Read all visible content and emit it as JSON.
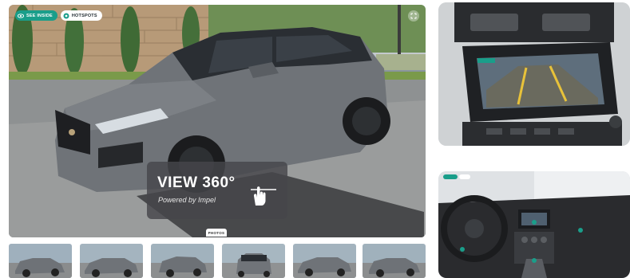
{
  "viewer": {
    "see_inside_label": "SEE INSIDE",
    "hotspots_label": "HOTSPOTS",
    "view360_title": "VIEW 360°",
    "view360_subtitle": "Powered by Impel",
    "photos_tab_label": "PHOTOS"
  },
  "icons": {
    "see_inside": "eye-icon",
    "hotspots": "target-icon",
    "expand": "expand-icon",
    "drag": "hand-drag-icon"
  },
  "thumbnails": [
    {
      "subject": "gray SUV front three-quarter"
    },
    {
      "subject": "gray SUV side view"
    },
    {
      "subject": "gray SUV rear three-quarter"
    },
    {
      "subject": "gray SUV rear view"
    },
    {
      "subject": "gray SUV side profile"
    },
    {
      "subject": "gray SUV front three-quarter"
    }
  ],
  "side_panels": [
    {
      "subject": "dashboard touchscreen showing backup camera"
    },
    {
      "subject": "interior 360 view of cockpit"
    }
  ],
  "colors": {
    "accent": "#1a9e8a",
    "overlay": "#46464a",
    "car_paint": "#6f7378"
  }
}
